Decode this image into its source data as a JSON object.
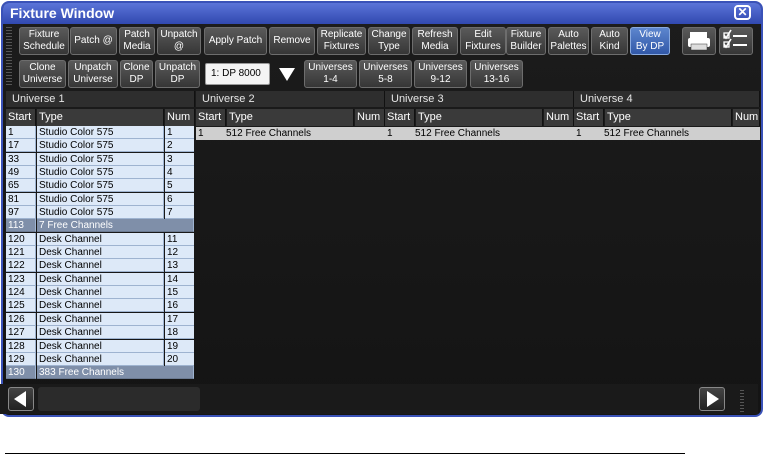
{
  "window": {
    "title": "Fixture Window"
  },
  "toolbar": {
    "row1": [
      {
        "id": "fixture-schedule-button",
        "label": "Fixture\nSchedule"
      },
      {
        "id": "patch-at-button",
        "label": "Patch @"
      },
      {
        "id": "patch-media-button",
        "label": "Patch\nMedia"
      },
      {
        "id": "unpatch-at-button",
        "label": "Unpatch\n@"
      },
      {
        "id": "apply-patch-button",
        "label": "Apply Patch"
      },
      {
        "id": "remove-button",
        "label": "Remove"
      },
      {
        "id": "replicate-fixtures-button",
        "label": "Replicate\nFixtures"
      },
      {
        "id": "change-type-button",
        "label": "Change\nType"
      },
      {
        "id": "refresh-media-button",
        "label": "Refresh\nMedia"
      },
      {
        "id": "edit-fixtures-button",
        "label": "Edit\nFixtures"
      },
      {
        "id": "fixture-builder-button",
        "label": "Fixture\nBuilder"
      },
      {
        "id": "auto-palettes-button",
        "label": "Auto\nPalettes"
      },
      {
        "id": "auto-kind-button",
        "label": "Auto\nKind"
      },
      {
        "id": "view-by-dp-button",
        "label": "View\nBy DP",
        "active": true
      }
    ],
    "row2": [
      {
        "id": "clone-universe-button",
        "label": "Clone\nUniverse"
      },
      {
        "id": "unpatch-universe-button",
        "label": "Unpatch\nUniverse"
      },
      {
        "id": "clone-dp-button",
        "label": "Clone\nDP"
      },
      {
        "id": "unpatch-dp-button",
        "label": "Unpatch\nDP"
      }
    ],
    "dp_select_value": "1: DP 8000",
    "universe_buttons": [
      {
        "id": "universes-1-4-button",
        "label": "Universes\n1-4"
      },
      {
        "id": "universes-5-8-button",
        "label": "Universes\n5-8"
      },
      {
        "id": "universes-9-12-button",
        "label": "Universes\n9-12"
      },
      {
        "id": "universes-13-16-button",
        "label": "Universes\n13-16"
      }
    ],
    "icons": [
      "print-icon",
      "checklist-icon"
    ]
  },
  "columns": {
    "start": "Start",
    "type": "Type",
    "num": "Num"
  },
  "universes": [
    {
      "name": "Universe 1",
      "rows": [
        {
          "start": "1",
          "type": "Studio Color 575",
          "num": "1"
        },
        {
          "start": "17",
          "type": "Studio Color 575",
          "num": "2"
        },
        {
          "start": "33",
          "type": "Studio Color 575",
          "num": "3"
        },
        {
          "start": "49",
          "type": "Studio Color 575",
          "num": "4"
        },
        {
          "start": "65",
          "type": "Studio Color 575",
          "num": "5"
        },
        {
          "start": "81",
          "type": "Studio Color 575",
          "num": "6"
        },
        {
          "start": "97",
          "type": "Studio Color 575",
          "num": "7"
        },
        {
          "start": "113",
          "type": "7 Free Channels",
          "num": "",
          "free": true
        },
        {
          "start": "120",
          "type": "Desk Channel",
          "num": "11"
        },
        {
          "start": "121",
          "type": "Desk Channel",
          "num": "12"
        },
        {
          "start": "122",
          "type": "Desk Channel",
          "num": "13"
        },
        {
          "start": "123",
          "type": "Desk Channel",
          "num": "14"
        },
        {
          "start": "124",
          "type": "Desk Channel",
          "num": "15"
        },
        {
          "start": "125",
          "type": "Desk Channel",
          "num": "16"
        },
        {
          "start": "126",
          "type": "Desk Channel",
          "num": "17"
        },
        {
          "start": "127",
          "type": "Desk Channel",
          "num": "18"
        },
        {
          "start": "128",
          "type": "Desk Channel",
          "num": "19"
        },
        {
          "start": "129",
          "type": "Desk Channel",
          "num": "20"
        },
        {
          "start": "130",
          "type": "383 Free Channels",
          "num": "",
          "free": true
        }
      ]
    },
    {
      "name": "Universe 2",
      "rows": [
        {
          "start": "1",
          "type": "512 Free Channels",
          "num": "",
          "free": true
        }
      ]
    },
    {
      "name": "Universe 3",
      "rows": [
        {
          "start": "1",
          "type": "512 Free Channels",
          "num": "",
          "free": true
        }
      ]
    },
    {
      "name": "Universe 4",
      "rows": [
        {
          "start": "1",
          "type": "512 Free Channels",
          "num": "",
          "free": true
        }
      ]
    }
  ],
  "colors": {
    "title_bar": "#3a52b8",
    "active_button": "#3158a8",
    "fixture_row": "#dde9f8",
    "free_row": "#7f8fa9"
  }
}
